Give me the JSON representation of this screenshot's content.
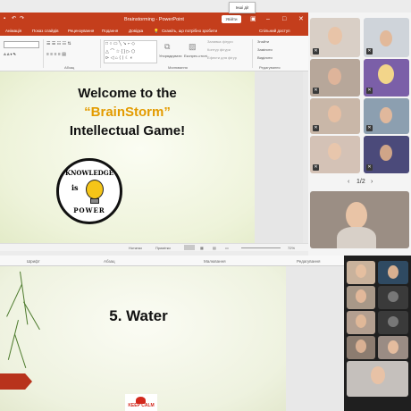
{
  "tooltip": "Інші дії",
  "top": {
    "window_title": "Brainstorming  -  PowerPoint",
    "signin_label": "Увійти",
    "ribbon_tabs": [
      "Анімація",
      "Показ слайдів",
      "Рецензування",
      "Подання",
      "Довідка",
      "Скажіть, що потрібно зробити",
      "Спільний доступ"
    ],
    "ribbon_groups": [
      "Абзац",
      "Малювання",
      "Редагування"
    ],
    "ribbon_labels": {
      "arrange": "Упорядкувати",
      "quick_styles": "Експрес-стилі",
      "fill": "Заливка фігури",
      "outline": "Контур фігури",
      "effects": "Ефекти для фігур",
      "find": "Знайти",
      "replace": "Замінити",
      "select": "Виділити"
    },
    "slide": {
      "line1": "Welcome to the",
      "line2": "“BrainStorm”",
      "line3": "Intellectual Game!",
      "logo_top": "KNOWLEDGE",
      "logo_mid": "is",
      "logo_bottom": "POWER"
    },
    "status": {
      "notes": "Нотатки",
      "comments": "Примітки",
      "zoom": "72%"
    },
    "pager": "1/2"
  },
  "bottom": {
    "ribbon_groups": [
      "Шрифт",
      "Абзац",
      "Малювання",
      "Редагування"
    ],
    "slide": {
      "question": "5. Water",
      "keep_calm": "KEEP CALM"
    }
  },
  "colors": {
    "accent": "#c43e1c",
    "brain_orange": "#e39b00",
    "keep_calm_red": "#d2281c"
  }
}
